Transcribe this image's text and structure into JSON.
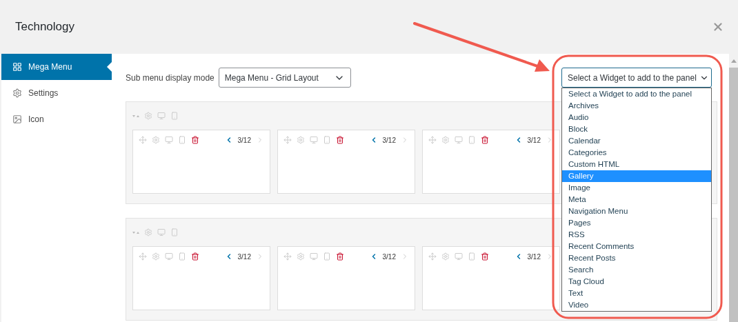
{
  "window": {
    "title": "Technology"
  },
  "sidebar": {
    "items": [
      {
        "label": "Mega Menu",
        "kind": "grid",
        "selected": true
      },
      {
        "label": "Settings",
        "kind": "gear",
        "selected": false
      },
      {
        "label": "Icon",
        "kind": "image",
        "selected": false
      }
    ]
  },
  "display_mode": {
    "label": "Sub menu display mode",
    "value": "Mega Menu - Grid Layout"
  },
  "widget_select": {
    "value": "Select a Widget to add to the panel",
    "expanded": true,
    "options": [
      {
        "label": "Select a Widget to add to the panel",
        "highlighted": false
      },
      {
        "label": "Archives",
        "highlighted": false
      },
      {
        "label": "Audio",
        "highlighted": false
      },
      {
        "label": "Block",
        "highlighted": false
      },
      {
        "label": "Calendar",
        "highlighted": false
      },
      {
        "label": "Categories",
        "highlighted": false
      },
      {
        "label": "Custom HTML",
        "highlighted": false
      },
      {
        "label": "Gallery",
        "highlighted": true
      },
      {
        "label": "Image",
        "highlighted": false
      },
      {
        "label": "Meta",
        "highlighted": false
      },
      {
        "label": "Navigation Menu",
        "highlighted": false
      },
      {
        "label": "Pages",
        "highlighted": false
      },
      {
        "label": "RSS",
        "highlighted": false
      },
      {
        "label": "Recent Comments",
        "highlighted": false
      },
      {
        "label": "Recent Posts",
        "highlighted": false
      },
      {
        "label": "Search",
        "highlighted": false
      },
      {
        "label": "Tag Cloud",
        "highlighted": false
      },
      {
        "label": "Text",
        "highlighted": false
      },
      {
        "label": "Video",
        "highlighted": false
      }
    ]
  },
  "rows": [
    {
      "columns": [
        {
          "span": "3/12"
        },
        {
          "span": "3/12"
        },
        {
          "span": "3/12"
        }
      ]
    },
    {
      "columns": [
        {
          "span": "3/12"
        },
        {
          "span": "3/12"
        },
        {
          "span": "3/12"
        }
      ]
    }
  ]
}
